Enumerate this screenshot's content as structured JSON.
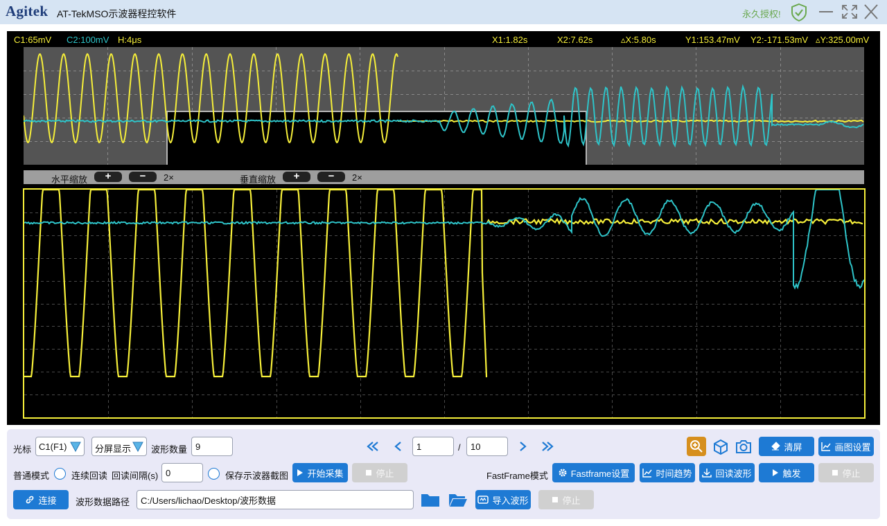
{
  "window": {
    "logo": "Agitek",
    "title": "AT-TekMSO示波器程控软件",
    "license": "永久授权!",
    "icons": [
      "shield-check-icon",
      "minimize-icon",
      "maximize-icon",
      "close-icon"
    ]
  },
  "scope": {
    "c1_scale": "C1:65mV",
    "c2_scale": "C2:100mV",
    "h_scale": "H:4μs",
    "x1": "X1:1.82s",
    "x2": "X2:7.62s",
    "dx": "▵X:5.80s",
    "y1": "Y1:153.47mV",
    "y2": "Y2:-171.53mV",
    "dy": "▵Y:325.00mV",
    "colors": {
      "ch1": "#f6ef3a",
      "ch2": "#2ec4c9",
      "plot_bg": "#000000",
      "overview_bg": "#545454"
    },
    "zoom": {
      "h_label": "水平缩放",
      "v_label": "垂直缩放",
      "plus": "+",
      "minus": "−",
      "h_factor": "2×",
      "v_factor": "2×"
    }
  },
  "controls": {
    "cursor_label": "光标",
    "cursor_value": "C1(F1)",
    "display_value": "分屏显示",
    "waveform_count_label": "波形数量",
    "waveform_count": "9",
    "page_current": "1",
    "page_sep": "/",
    "page_total": "10",
    "clear_button": "清屏",
    "plot_settings_button": "画图设置",
    "normal_mode": "普通模式",
    "continuous_readback": "连续回读",
    "readback_interval_label": "回读间隔(s)",
    "readback_interval": "0",
    "save_screenshot": "保存示波器截图",
    "start_acquire_button": "开始采集",
    "stop_button_1": "停止",
    "fastframe_mode": "FastFrame模式",
    "fastframe_settings_button": "Fastframe设置",
    "time_trend_button": "时间趋势",
    "readback_waveform_button": "回读波形",
    "trigger_button": "触发",
    "stop_button_2": "停止",
    "connect_button": "连接",
    "data_path_label": "波形数据路径",
    "data_path": "C:/Users/lichao/Desktop/波形数据",
    "import_waveform_button": "导入波形",
    "stop_button_3": "停止",
    "accent_color": "#1e7ad4"
  }
}
